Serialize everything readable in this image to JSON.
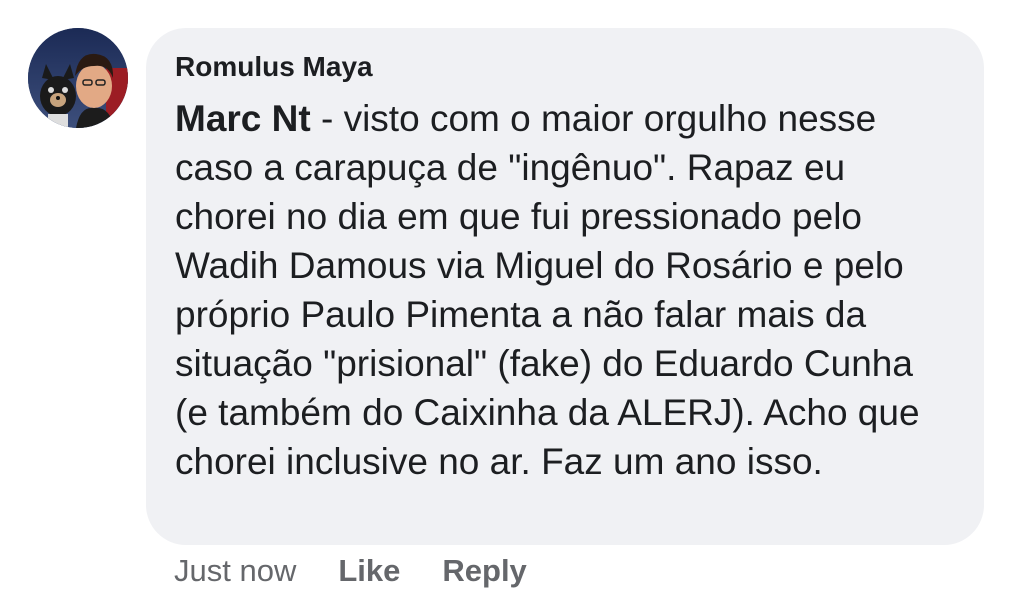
{
  "comment": {
    "author_name": "Romulus Maya",
    "mention": "Marc Nt",
    "text": " - visto com o maior orgulho nesse caso a carapuça de \"ingênuo\". Rapaz eu chorei no dia em que fui pressionado pelo Wadih Damous via Miguel do Rosário e pelo próprio Paulo Pimenta a não falar mais da situação \"prisional\" (fake) do Eduardo Cunha (e também do Caixinha da ALERJ). Acho que chorei inclusive no ar. Faz um ano isso.",
    "timestamp": "Just now",
    "like_label": "Like",
    "reply_label": "Reply"
  },
  "colors": {
    "bubble_background": "#f0f1f4",
    "text": "#1c1e21",
    "meta_text": "#65676b"
  }
}
